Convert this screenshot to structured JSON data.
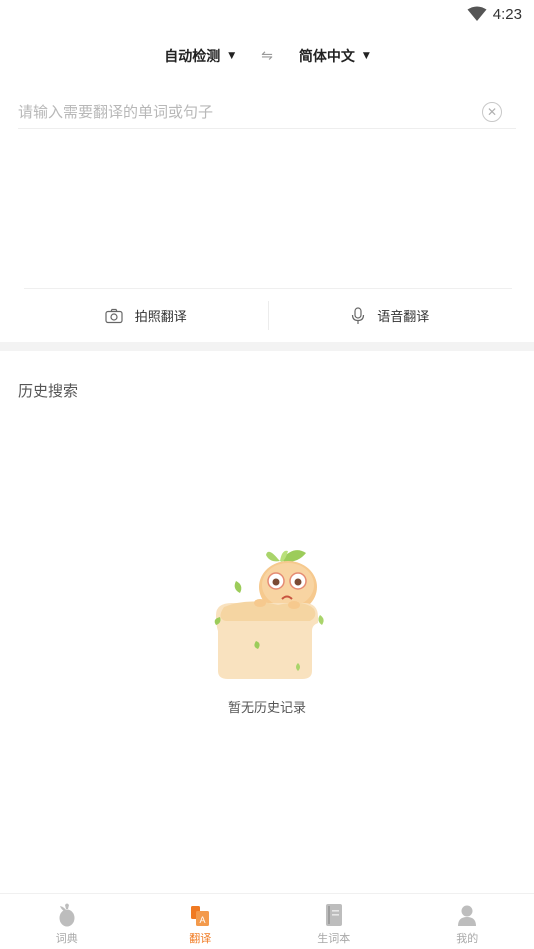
{
  "status_bar": {
    "time": "4:23"
  },
  "language_bar": {
    "source": "自动检测",
    "swap_symbol": "⇋",
    "target": "简体中文"
  },
  "input": {
    "placeholder": "请输入需要翻译的单词或句子",
    "value": ""
  },
  "actions": {
    "photo_label": "拍照翻译",
    "voice_label": "语音翻译"
  },
  "history": {
    "title": "历史搜索",
    "empty_text": "暂无历史记录"
  },
  "tabs": [
    {
      "label": "词典",
      "icon": "radish-icon",
      "active": false
    },
    {
      "label": "翻译",
      "icon": "translate-icon",
      "active": true
    },
    {
      "label": "生词本",
      "icon": "notebook-icon",
      "active": false
    },
    {
      "label": "我的",
      "icon": "user-icon",
      "active": false
    }
  ],
  "colors": {
    "accent": "#f07a22",
    "inactive": "#a8a8a8"
  }
}
